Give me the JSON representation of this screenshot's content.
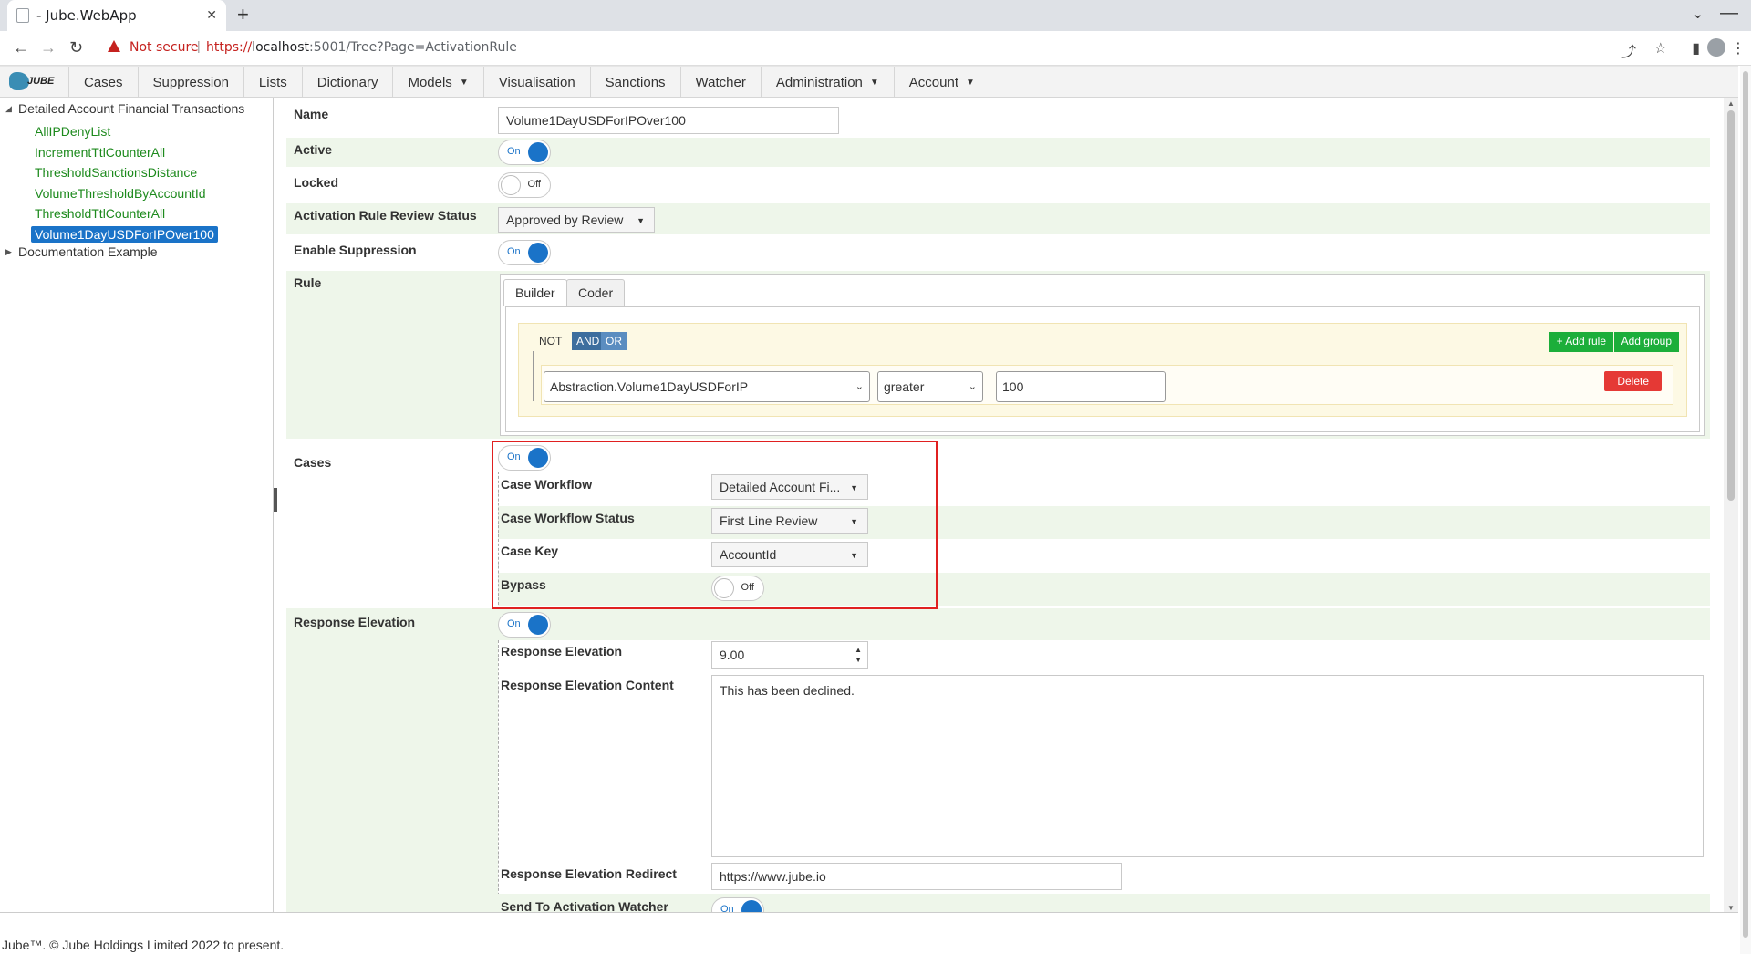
{
  "browser": {
    "tab_title": "- Jube.WebApp",
    "url_warning": "Not secure",
    "url_scheme": "https://",
    "url_host": "localhost",
    "url_rest": ":5001/Tree?Page=ActivationRule"
  },
  "menu": {
    "logo_text": "JUBE",
    "items": [
      {
        "label": "Cases",
        "dropdown": false
      },
      {
        "label": "Suppression",
        "dropdown": false
      },
      {
        "label": "Lists",
        "dropdown": false
      },
      {
        "label": "Dictionary",
        "dropdown": false
      },
      {
        "label": "Models",
        "dropdown": true
      },
      {
        "label": "Visualisation",
        "dropdown": false
      },
      {
        "label": "Sanctions",
        "dropdown": false
      },
      {
        "label": "Watcher",
        "dropdown": false
      },
      {
        "label": "Administration",
        "dropdown": true
      },
      {
        "label": "Account",
        "dropdown": true
      }
    ]
  },
  "tree": {
    "root1": "Detailed Account Financial Transactions",
    "leaves": [
      "AllIPDenyList",
      "IncrementTtlCounterAll",
      "ThresholdSanctionsDistance",
      "VolumeThresholdByAccountId",
      "ThresholdTtlCounterAll",
      "Volume1DayUSDForIPOver100"
    ],
    "selected_index": 5,
    "root2": "Documentation Example"
  },
  "form": {
    "name_label": "Name",
    "name_value": "Volume1DayUSDForIPOver100",
    "active_label": "Active",
    "locked_label": "Locked",
    "review_label": "Activation Rule Review Status",
    "review_value": "Approved by Review",
    "suppression_label": "Enable Suppression",
    "rule_label": "Rule",
    "cases_label": "Cases",
    "case_workflow_label": "Case Workflow",
    "case_workflow_value": "Detailed Account Fi...",
    "case_workflow_status_label": "Case Workflow Status",
    "case_workflow_status_value": "First Line Review",
    "case_key_label": "Case Key",
    "case_key_value": "AccountId",
    "bypass_label": "Bypass",
    "response_elevation_section_label": "Response Elevation",
    "response_elevation_label": "Response Elevation",
    "response_elevation_value": "9.00",
    "response_content_label": "Response Elevation Content",
    "response_content_value": "This has been declined.",
    "response_redirect_label": "Response Elevation Redirect",
    "response_redirect_value": "https://www.jube.io",
    "send_watcher_label": "Send To Activation Watcher",
    "toggle_on": "On",
    "toggle_off": "Off"
  },
  "rule_builder": {
    "tab_builder": "Builder",
    "tab_coder": "Coder",
    "not_label": "NOT",
    "and_label": "AND",
    "or_label": "OR",
    "add_rule": "+ Add rule",
    "add_group": "Add group",
    "field": "Abstraction.Volume1DayUSDForIP",
    "operator": "greater",
    "value": "100",
    "delete": "Delete"
  },
  "footer": {
    "text": "Jube™. © Jube Holdings Limited 2022 to present."
  }
}
